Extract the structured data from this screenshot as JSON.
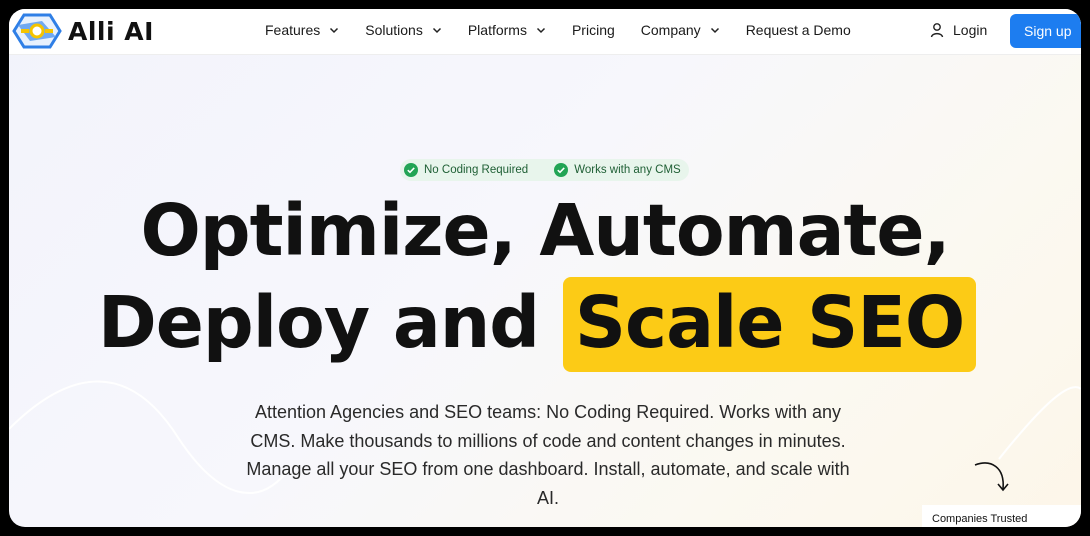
{
  "brand": {
    "name": "Alli AI"
  },
  "nav": {
    "items": [
      {
        "label": "Features",
        "has_dropdown": true
      },
      {
        "label": "Solutions",
        "has_dropdown": true
      },
      {
        "label": "Platforms",
        "has_dropdown": true
      },
      {
        "label": "Pricing",
        "has_dropdown": false
      },
      {
        "label": "Company",
        "has_dropdown": true
      },
      {
        "label": "Request a Demo",
        "has_dropdown": false
      }
    ],
    "login_label": "Login",
    "signup_label": "Sign up"
  },
  "hero": {
    "badges": [
      "No Coding Required",
      "Works with any CMS"
    ],
    "headline_line1": "Optimize, Automate,",
    "headline_line2_plain": "Deploy and",
    "headline_line2_highlight": "Scale SEO",
    "description": "Attention Agencies and SEO teams: No Coding Required. Works with any CMS. Make thousands to millions of code and content changes in minutes. Manage all your SEO from one dashboard. Install, automate, and scale with AI."
  },
  "trusted_label": "Companies Trusted",
  "colors": {
    "accent": "#1d7df0",
    "highlight": "#fccb16",
    "badge_bg": "#e8f5ec",
    "check": "#22a455"
  }
}
